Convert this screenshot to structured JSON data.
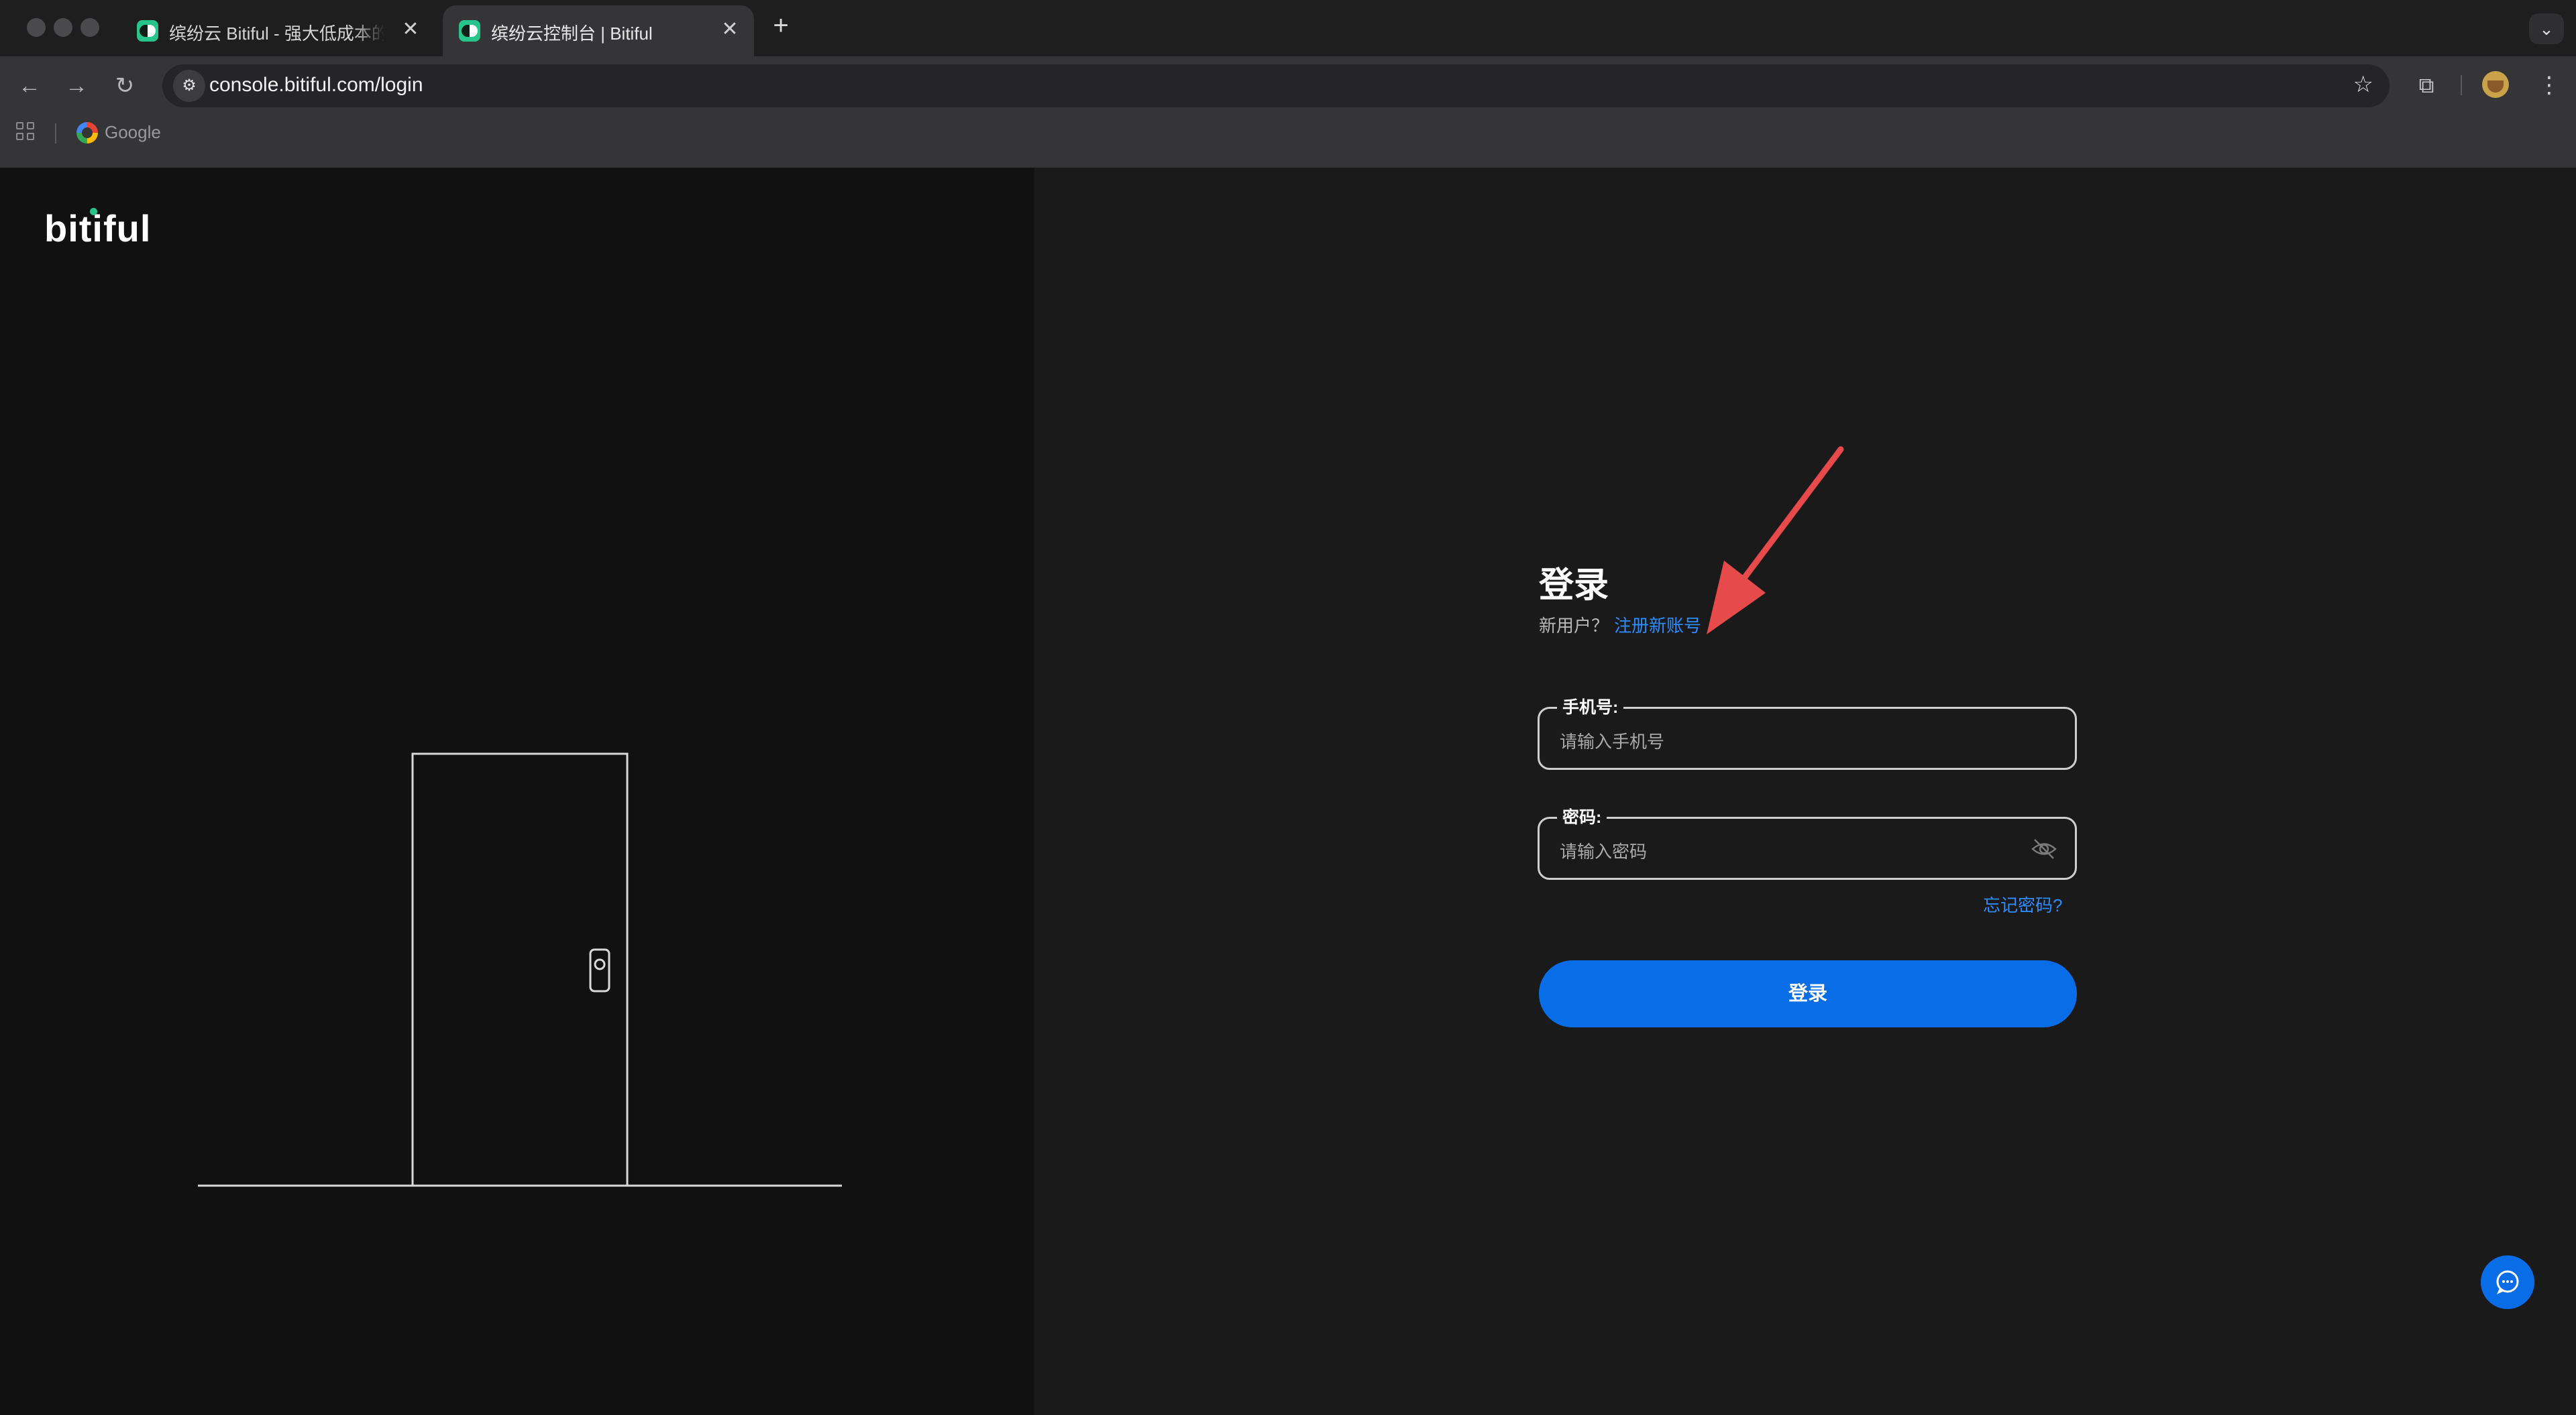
{
  "browser": {
    "tabs": [
      {
        "title": "缤纷云 Bitiful - 强大低成本的对象存储",
        "active": false
      },
      {
        "title": "缤纷云控制台 | Bitiful",
        "active": true
      }
    ],
    "tab_close": "✕",
    "new_tab": "+",
    "tab_menu": "⌄",
    "url": "console.bitiful.com/login",
    "bookmarks": [
      {
        "label": "Google",
        "icon": "google-icon"
      }
    ]
  },
  "page": {
    "logo": "bitiful",
    "title": "登录",
    "signup_prompt": "新用户？",
    "signup_link": "注册新账号",
    "phone_label": "手机号:",
    "phone_placeholder": "请输入手机号",
    "password_label": "密码:",
    "password_placeholder": "请输入密码",
    "forgot_password": "忘记密码?",
    "login_button": "登录"
  },
  "colors": {
    "accent": "#0a6de8",
    "link": "#2d8cff",
    "annotation_arrow": "#e64a4a",
    "brand_green": "#27c58c"
  }
}
